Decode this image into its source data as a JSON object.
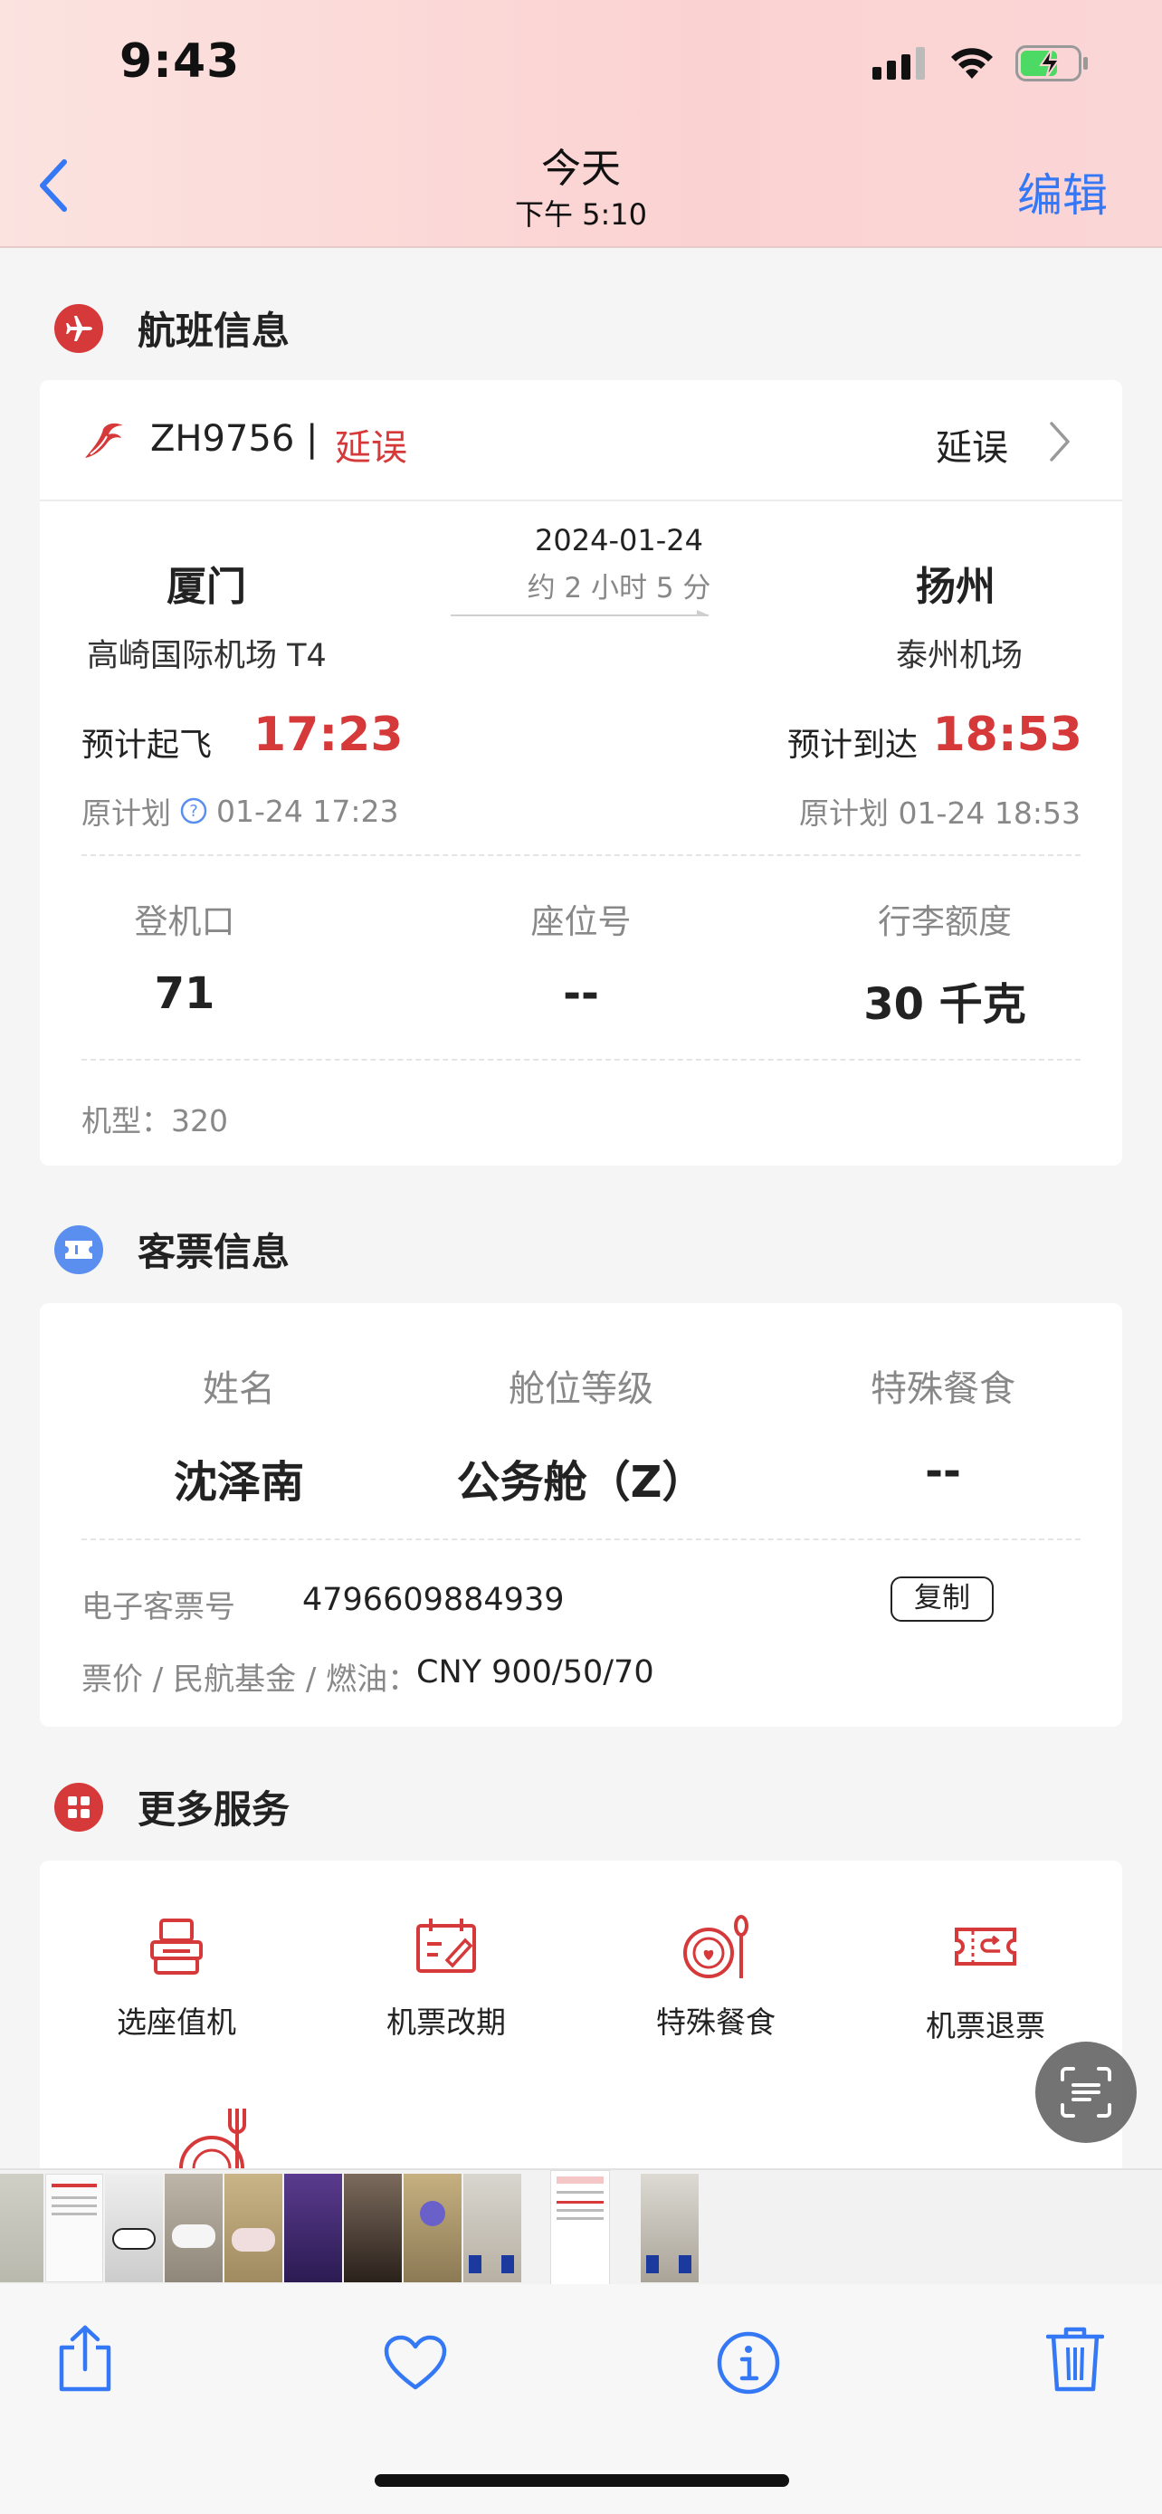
{
  "status_bar": {
    "time": "9:43"
  },
  "nav": {
    "title": "今天",
    "subtitle": "下午 5:10",
    "edit_label": "编辑"
  },
  "flight_section": {
    "title": "航班信息",
    "flight_no": "ZH9756 |",
    "flight_status": "延误",
    "header_status": "延误",
    "date": "2024-01-24",
    "duration": "约 2 小时 5 分",
    "from_city": "厦门",
    "from_airport": "高崎国际机场 T4",
    "to_city": "扬州",
    "to_airport": "泰州机场",
    "dep_label": "预计起飞",
    "dep_time": "17:23",
    "arr_label": "预计到达",
    "arr_time": "18:53",
    "dep_plan_label": "原计划",
    "dep_plan_value": "01-24 17:23",
    "arr_plan": "原计划 01-24 18:53",
    "gate_label": "登机口",
    "gate_value": "71",
    "seat_label": "座位号",
    "seat_value": "--",
    "baggage_label": "行李额度",
    "baggage_value": "30 千克",
    "aircraft": "机型：320"
  },
  "ticket_section": {
    "title": "客票信息",
    "name_label": "姓名",
    "name_value": "沈泽南",
    "class_label": "舱位等级",
    "class_value": "公务舱（Z）",
    "meal_label": "特殊餐食",
    "meal_value": "--",
    "eticket_label": "电子客票号",
    "eticket_value": "4796609884939",
    "copy_label": "复制",
    "price_label": "票价 / 民航基金 / 燃油：",
    "price_value": "CNY 900/50/70"
  },
  "services_section": {
    "title": "更多服务",
    "items": [
      {
        "label": "选座值机",
        "icon": "seat-icon"
      },
      {
        "label": "机票改期",
        "icon": "reschedule-icon"
      },
      {
        "label": "特殊餐食",
        "icon": "meal-icon"
      },
      {
        "label": "机票退票",
        "icon": "refund-ticket-icon"
      }
    ]
  },
  "colors": {
    "accent_red": "#d6393a",
    "ios_blue": "#3478f6",
    "ticket_icon_blue": "#5a8ff0"
  }
}
